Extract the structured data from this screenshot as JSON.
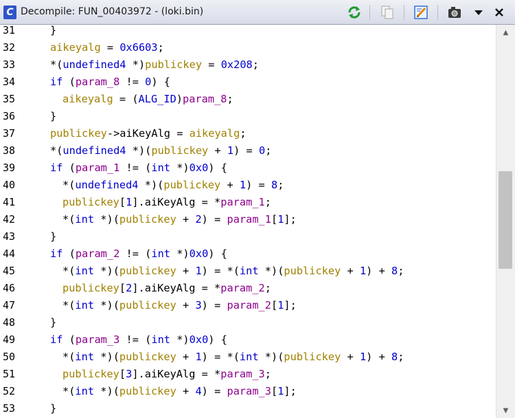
{
  "window": {
    "title": "Decompile: FUN_00403972 -  (loki.bin)",
    "icon_letter": "C",
    "toolbar": [
      {
        "name": "refresh-icon",
        "label": "Refresh"
      },
      {
        "name": "copy-icon",
        "label": "Copy"
      },
      {
        "name": "edit-function-signature-icon",
        "label": "Edit Function Signature"
      },
      {
        "name": "snapshot-icon",
        "label": "Snapshot"
      },
      {
        "name": "menu-dropdown-icon",
        "label": "More"
      },
      {
        "name": "close-icon",
        "label": "Close"
      }
    ]
  },
  "colors": {
    "keyword": "#0000cc",
    "variable": "#a08000",
    "parameter": "#8b008b",
    "plain": "#000000"
  },
  "code_lines": [
    {
      "n": "31",
      "indent": 1,
      "tokens": [
        [
          "p",
          "}"
        ]
      ]
    },
    {
      "n": "32",
      "indent": 1,
      "tokens": [
        [
          "v",
          "aikeyalg"
        ],
        [
          "p",
          " = "
        ],
        [
          "k",
          "0x6603"
        ],
        [
          "p",
          ";"
        ]
      ]
    },
    {
      "n": "33",
      "indent": 1,
      "tokens": [
        [
          "p",
          "*("
        ],
        [
          "k",
          "undefined4"
        ],
        [
          "p",
          " *)"
        ],
        [
          "v",
          "publickey"
        ],
        [
          "p",
          " = "
        ],
        [
          "k",
          "0x208"
        ],
        [
          "p",
          ";"
        ]
      ]
    },
    {
      "n": "34",
      "indent": 1,
      "tokens": [
        [
          "k",
          "if"
        ],
        [
          "p",
          " ("
        ],
        [
          "a",
          "param_8"
        ],
        [
          "p",
          " != "
        ],
        [
          "k",
          "0"
        ],
        [
          "p",
          ") {"
        ]
      ]
    },
    {
      "n": "35",
      "indent": 2,
      "tokens": [
        [
          "v",
          "aikeyalg"
        ],
        [
          "p",
          " = ("
        ],
        [
          "k",
          "ALG_ID"
        ],
        [
          "p",
          ")"
        ],
        [
          "a",
          "param_8"
        ],
        [
          "p",
          ";"
        ]
      ]
    },
    {
      "n": "36",
      "indent": 1,
      "tokens": [
        [
          "p",
          "}"
        ]
      ]
    },
    {
      "n": "37",
      "indent": 1,
      "tokens": [
        [
          "v",
          "publickey"
        ],
        [
          "p",
          "->aiKeyAlg = "
        ],
        [
          "v",
          "aikeyalg"
        ],
        [
          "p",
          ";"
        ]
      ]
    },
    {
      "n": "38",
      "indent": 1,
      "tokens": [
        [
          "p",
          "*("
        ],
        [
          "k",
          "undefined4"
        ],
        [
          "p",
          " *)("
        ],
        [
          "v",
          "publickey"
        ],
        [
          "p",
          " + "
        ],
        [
          "k",
          "1"
        ],
        [
          "p",
          ") = "
        ],
        [
          "k",
          "0"
        ],
        [
          "p",
          ";"
        ]
      ]
    },
    {
      "n": "39",
      "indent": 1,
      "tokens": [
        [
          "k",
          "if"
        ],
        [
          "p",
          " ("
        ],
        [
          "a",
          "param_1"
        ],
        [
          "p",
          " != ("
        ],
        [
          "k",
          "int"
        ],
        [
          "p",
          " *)"
        ],
        [
          "k",
          "0x0"
        ],
        [
          "p",
          ") {"
        ]
      ]
    },
    {
      "n": "40",
      "indent": 2,
      "tokens": [
        [
          "p",
          "*("
        ],
        [
          "k",
          "undefined4"
        ],
        [
          "p",
          " *)("
        ],
        [
          "v",
          "publickey"
        ],
        [
          "p",
          " + "
        ],
        [
          "k",
          "1"
        ],
        [
          "p",
          ") = "
        ],
        [
          "k",
          "8"
        ],
        [
          "p",
          ";"
        ]
      ]
    },
    {
      "n": "41",
      "indent": 2,
      "tokens": [
        [
          "v",
          "publickey"
        ],
        [
          "p",
          "["
        ],
        [
          "k",
          "1"
        ],
        [
          "p",
          "].aiKeyAlg = *"
        ],
        [
          "a",
          "param_1"
        ],
        [
          "p",
          ";"
        ]
      ]
    },
    {
      "n": "42",
      "indent": 2,
      "tokens": [
        [
          "p",
          "*("
        ],
        [
          "k",
          "int"
        ],
        [
          "p",
          " *)("
        ],
        [
          "v",
          "publickey"
        ],
        [
          "p",
          " + "
        ],
        [
          "k",
          "2"
        ],
        [
          "p",
          ") = "
        ],
        [
          "a",
          "param_1"
        ],
        [
          "p",
          "["
        ],
        [
          "k",
          "1"
        ],
        [
          "p",
          "];"
        ]
      ]
    },
    {
      "n": "43",
      "indent": 1,
      "tokens": [
        [
          "p",
          "}"
        ]
      ]
    },
    {
      "n": "44",
      "indent": 1,
      "tokens": [
        [
          "k",
          "if"
        ],
        [
          "p",
          " ("
        ],
        [
          "a",
          "param_2"
        ],
        [
          "p",
          " != ("
        ],
        [
          "k",
          "int"
        ],
        [
          "p",
          " *)"
        ],
        [
          "k",
          "0x0"
        ],
        [
          "p",
          ") {"
        ]
      ]
    },
    {
      "n": "45",
      "indent": 2,
      "tokens": [
        [
          "p",
          "*("
        ],
        [
          "k",
          "int"
        ],
        [
          "p",
          " *)("
        ],
        [
          "v",
          "publickey"
        ],
        [
          "p",
          " + "
        ],
        [
          "k",
          "1"
        ],
        [
          "p",
          ") = *("
        ],
        [
          "k",
          "int"
        ],
        [
          "p",
          " *)("
        ],
        [
          "v",
          "publickey"
        ],
        [
          "p",
          " + "
        ],
        [
          "k",
          "1"
        ],
        [
          "p",
          ") + "
        ],
        [
          "k",
          "8"
        ],
        [
          "p",
          ";"
        ]
      ]
    },
    {
      "n": "46",
      "indent": 2,
      "tokens": [
        [
          "v",
          "publickey"
        ],
        [
          "p",
          "["
        ],
        [
          "k",
          "2"
        ],
        [
          "p",
          "].aiKeyAlg = *"
        ],
        [
          "a",
          "param_2"
        ],
        [
          "p",
          ";"
        ]
      ]
    },
    {
      "n": "47",
      "indent": 2,
      "tokens": [
        [
          "p",
          "*("
        ],
        [
          "k",
          "int"
        ],
        [
          "p",
          " *)("
        ],
        [
          "v",
          "publickey"
        ],
        [
          "p",
          " + "
        ],
        [
          "k",
          "3"
        ],
        [
          "p",
          ") = "
        ],
        [
          "a",
          "param_2"
        ],
        [
          "p",
          "["
        ],
        [
          "k",
          "1"
        ],
        [
          "p",
          "];"
        ]
      ]
    },
    {
      "n": "48",
      "indent": 1,
      "tokens": [
        [
          "p",
          "}"
        ]
      ]
    },
    {
      "n": "49",
      "indent": 1,
      "tokens": [
        [
          "k",
          "if"
        ],
        [
          "p",
          " ("
        ],
        [
          "a",
          "param_3"
        ],
        [
          "p",
          " != ("
        ],
        [
          "k",
          "int"
        ],
        [
          "p",
          " *)"
        ],
        [
          "k",
          "0x0"
        ],
        [
          "p",
          ") {"
        ]
      ]
    },
    {
      "n": "50",
      "indent": 2,
      "tokens": [
        [
          "p",
          "*("
        ],
        [
          "k",
          "int"
        ],
        [
          "p",
          " *)("
        ],
        [
          "v",
          "publickey"
        ],
        [
          "p",
          " + "
        ],
        [
          "k",
          "1"
        ],
        [
          "p",
          ") = *("
        ],
        [
          "k",
          "int"
        ],
        [
          "p",
          " *)("
        ],
        [
          "v",
          "publickey"
        ],
        [
          "p",
          " + "
        ],
        [
          "k",
          "1"
        ],
        [
          "p",
          ") + "
        ],
        [
          "k",
          "8"
        ],
        [
          "p",
          ";"
        ]
      ]
    },
    {
      "n": "51",
      "indent": 2,
      "tokens": [
        [
          "v",
          "publickey"
        ],
        [
          "p",
          "["
        ],
        [
          "k",
          "3"
        ],
        [
          "p",
          "].aiKeyAlg = *"
        ],
        [
          "a",
          "param_3"
        ],
        [
          "p",
          ";"
        ]
      ]
    },
    {
      "n": "52",
      "indent": 2,
      "tokens": [
        [
          "p",
          "*("
        ],
        [
          "k",
          "int"
        ],
        [
          "p",
          " *)("
        ],
        [
          "v",
          "publickey"
        ],
        [
          "p",
          " + "
        ],
        [
          "k",
          "4"
        ],
        [
          "p",
          ") = "
        ],
        [
          "a",
          "param_3"
        ],
        [
          "p",
          "["
        ],
        [
          "k",
          "1"
        ],
        [
          "p",
          "];"
        ]
      ]
    },
    {
      "n": "53",
      "indent": 1,
      "tokens": [
        [
          "p",
          "}"
        ]
      ]
    }
  ]
}
